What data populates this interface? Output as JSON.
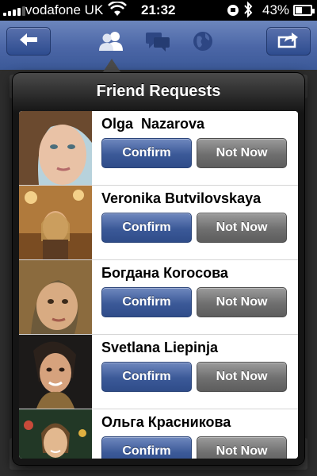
{
  "status_bar": {
    "carrier": "vodafone UK",
    "time": "21:32",
    "battery_percent": "43%",
    "battery_level": 0.43,
    "icons": [
      "signal-bars-icon",
      "wifi-icon",
      "lock-rotation-icon",
      "bluetooth-icon",
      "battery-icon"
    ]
  },
  "header": {
    "back_icon": "back-arrow-icon",
    "nav_icons": [
      "friend-requests-icon",
      "messages-icon",
      "notifications-globe-icon"
    ],
    "active_nav": "friend-requests-icon",
    "share_icon": "share-arrow-icon",
    "colors": {
      "header": "#4b66a6",
      "confirm": "#3b5998",
      "not_now": "#6f6f6f"
    }
  },
  "popover": {
    "title": "Friend Requests",
    "requests": [
      {
        "name": "Olga  Nazarova",
        "confirm_label": "Confirm",
        "not_now_label": "Not Now"
      },
      {
        "name": "Veronika Butvilovskaya",
        "confirm_label": "Confirm",
        "not_now_label": "Not Now"
      },
      {
        "name": "Богдана Когосова",
        "confirm_label": "Confirm",
        "not_now_label": "Not Now"
      },
      {
        "name": "Svetlana Liepinja",
        "confirm_label": "Confirm",
        "not_now_label": "Not Now"
      },
      {
        "name": "Ольга Красникова",
        "confirm_label": "Confirm",
        "not_now_label": "Not Now"
      }
    ]
  }
}
